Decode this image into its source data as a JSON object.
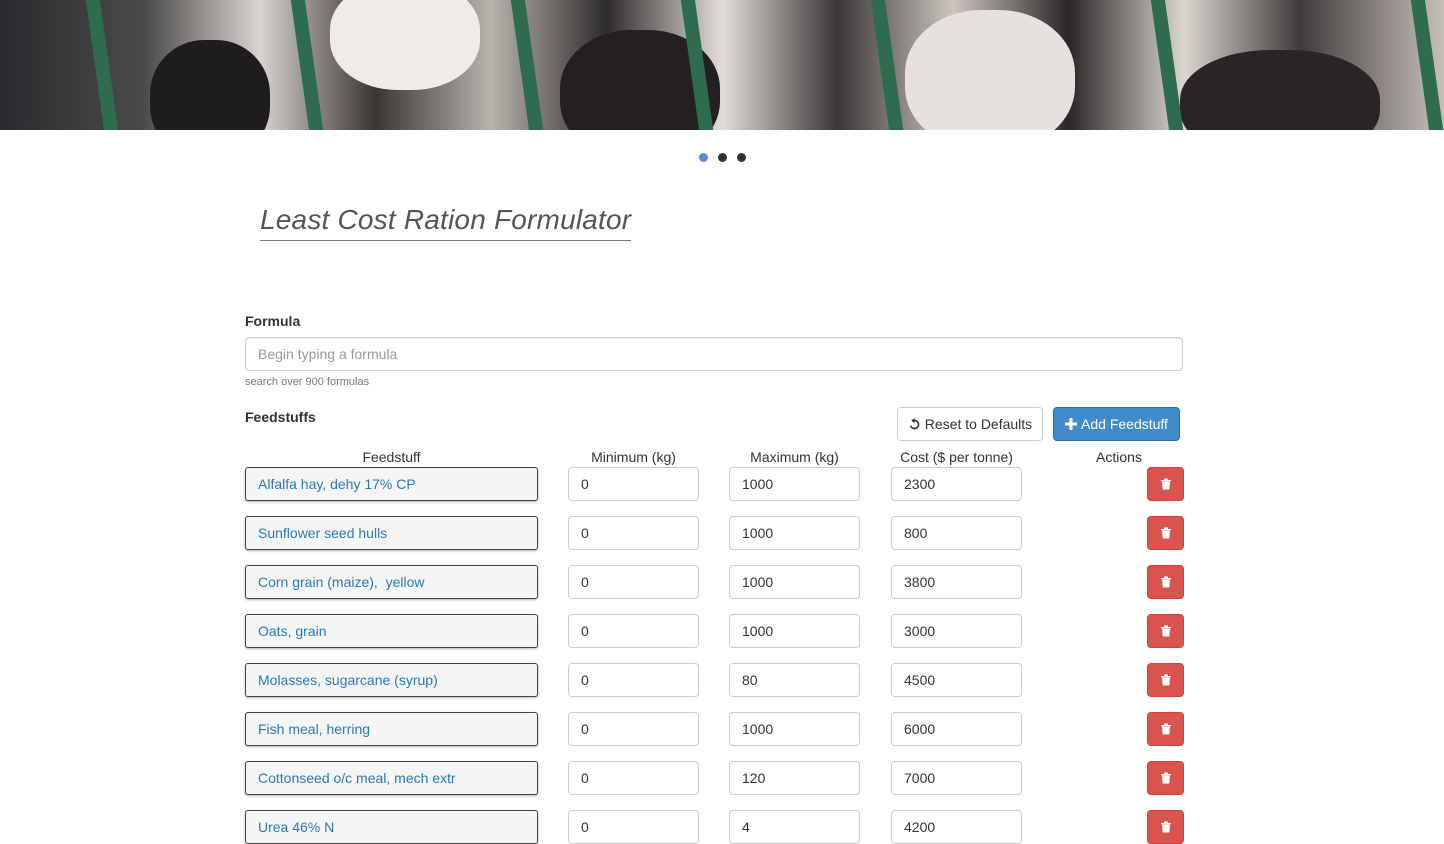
{
  "carousel": {
    "slides": 3,
    "active": 0
  },
  "title": "Least Cost Ration Formulator",
  "formula": {
    "label": "Formula",
    "placeholder": "Begin typing a formula",
    "help": "search over 900 formulas"
  },
  "feedstuffs": {
    "label": "Feedstuffs",
    "reset_label": "Reset to Defaults",
    "add_label": "Add Feedstuff",
    "columns": {
      "feedstuff": "Feedstuff",
      "minimum": "Minimum (kg)",
      "maximum": "Maximum (kg)",
      "cost": "Cost ($ per tonne)",
      "actions": "Actions"
    },
    "rows": [
      {
        "name": "Alfalfa hay, dehy 17% CP",
        "min": "0",
        "max": "1000",
        "cost": "2300"
      },
      {
        "name": "Sunflower seed hulls",
        "min": "0",
        "max": "1000",
        "cost": "800"
      },
      {
        "name": "Corn grain (maize),  yellow",
        "min": "0",
        "max": "1000",
        "cost": "3800"
      },
      {
        "name": "Oats, grain",
        "min": "0",
        "max": "1000",
        "cost": "3000"
      },
      {
        "name": "Molasses, sugarcane (syrup)",
        "min": "0",
        "max": "80",
        "cost": "4500"
      },
      {
        "name": "Fish meal, herring",
        "min": "0",
        "max": "1000",
        "cost": "6000"
      },
      {
        "name": "Cottonseed o/c meal, mech extr",
        "min": "0",
        "max": "120",
        "cost": "7000"
      },
      {
        "name": "Urea 46% N",
        "min": "0",
        "max": "4",
        "cost": "4200"
      }
    ]
  },
  "colors": {
    "link": "#2a7ab8",
    "primary": "#428bca",
    "danger": "#d9534f"
  },
  "icons": {
    "reset": "undo-icon",
    "add": "plus-icon",
    "delete": "trash-icon"
  }
}
